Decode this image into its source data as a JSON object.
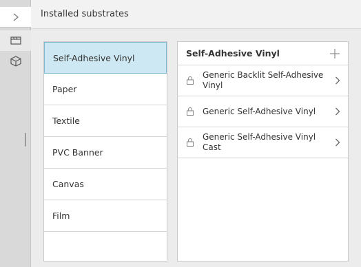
{
  "header": {
    "title": "Installed substrates"
  },
  "rail": {
    "toggle_icon": "chevron-right-icon",
    "buttons": [
      {
        "icon": "substrate-roll-icon"
      },
      {
        "icon": "cube-icon"
      }
    ]
  },
  "categories": [
    {
      "label": "Self-Adhesive Vinyl",
      "selected": true
    },
    {
      "label": "Paper",
      "selected": false
    },
    {
      "label": "Textile",
      "selected": false
    },
    {
      "label": "PVC Banner",
      "selected": false
    },
    {
      "label": "Canvas",
      "selected": false
    },
    {
      "label": "Film",
      "selected": false
    }
  ],
  "detail": {
    "title": "Self-Adhesive Vinyl",
    "add_icon": "plus-icon",
    "items": [
      {
        "label": "Generic Backlit Self-Adhesive Vinyl",
        "icon": "lock-icon"
      },
      {
        "label": "Generic Self-Adhesive Vinyl",
        "icon": "lock-icon"
      },
      {
        "label": "Generic Self-Adhesive Vinyl Cast",
        "icon": "lock-icon"
      }
    ]
  },
  "colors": {
    "selected_bg": "#cde8f2",
    "selected_border": "#7fb8d2",
    "rail_bg": "#d9d9d9",
    "content_bg": "#ececec"
  }
}
